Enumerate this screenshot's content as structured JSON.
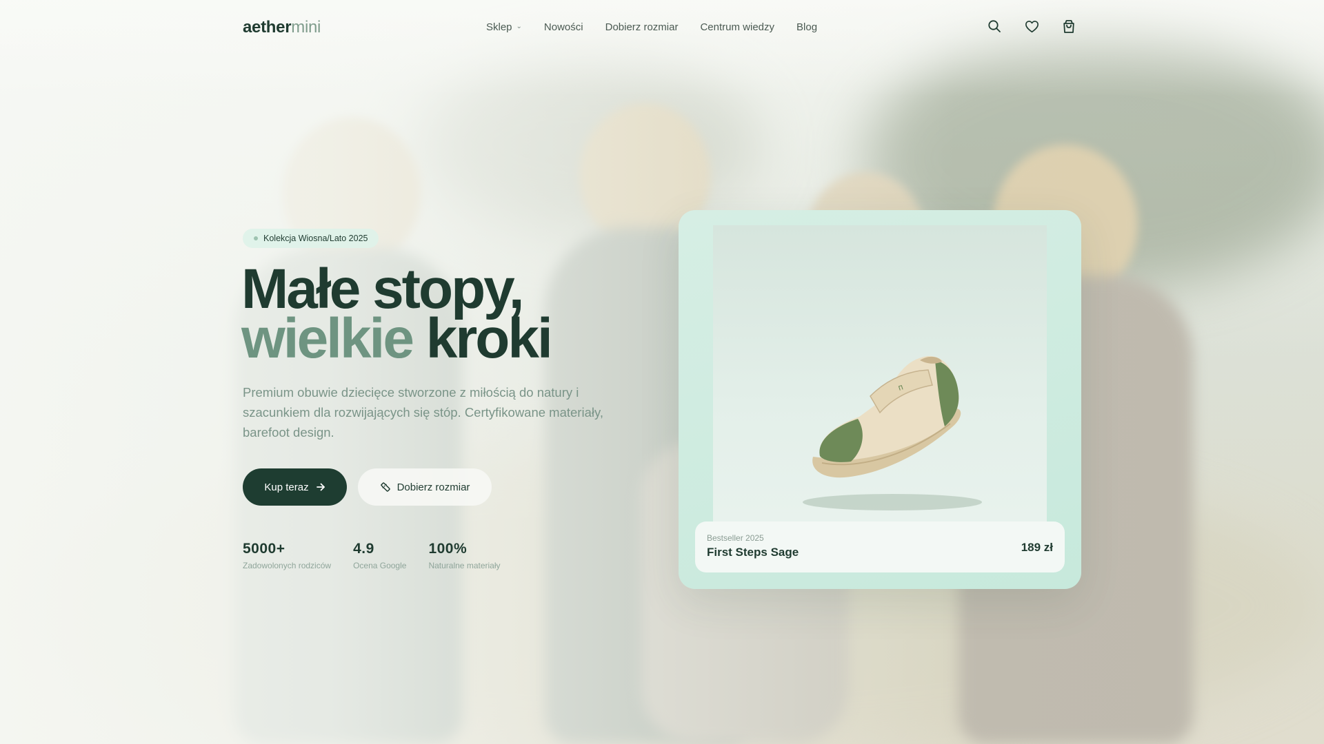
{
  "brand": {
    "part1": "aether",
    "part2": "mini"
  },
  "nav": {
    "items": [
      {
        "label": "Sklep",
        "has_dropdown": true
      },
      {
        "label": "Nowości"
      },
      {
        "label": "Dobierz rozmiar"
      },
      {
        "label": "Centrum wiedzy"
      },
      {
        "label": "Blog"
      }
    ],
    "icons": [
      "search-icon",
      "heart-icon",
      "shopping-bag-icon"
    ]
  },
  "hero": {
    "badge": "Kolekcja Wiosna/Lato 2025",
    "title_line1": "Małe stopy,",
    "title_line2_accent": "wielkie",
    "title_line2_rest": "kroki",
    "description": "Premium obuwie dziecięce stworzone z miłością do natury i szacunkiem dla rozwijających się stóp. Certyfikowane materiały, barefoot design.",
    "cta_primary": "Kup teraz",
    "cta_secondary": "Dobierz rozmiar"
  },
  "stats": [
    {
      "value": "5000+",
      "label": "Zadowolonych rodziców"
    },
    {
      "value": "4.9",
      "label": "Ocena Google"
    },
    {
      "value": "100%",
      "label": "Naturalne materiały"
    }
  ],
  "product_card": {
    "kicker": "Bestseller 2025",
    "name": "First Steps Sage",
    "price": "189 zł"
  },
  "colors": {
    "brand_dark": "#1e3d31",
    "accent": "#6e9481",
    "card_bg": "#c9eadd",
    "shoe_green": "#6f8b5a",
    "shoe_cream": "#eadfc6"
  }
}
